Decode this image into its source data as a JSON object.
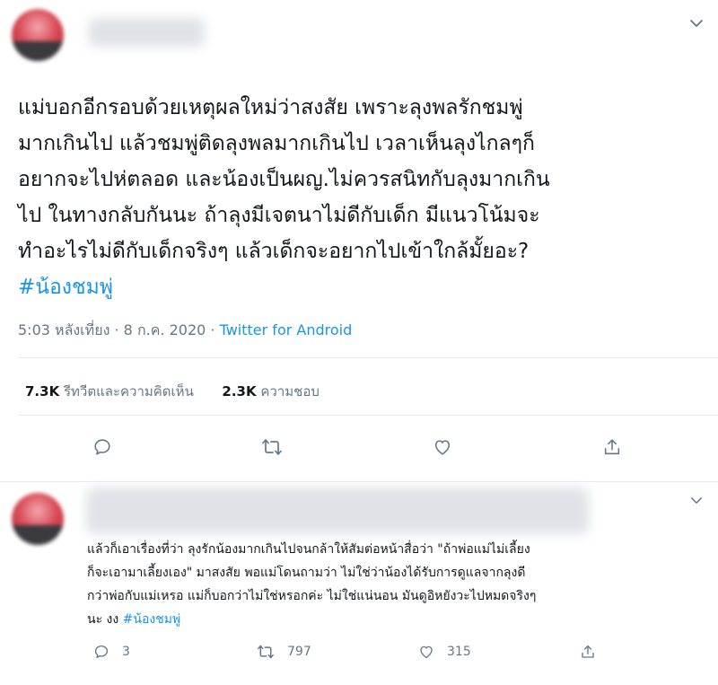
{
  "main_tweet": {
    "text_lines": [
      "แม่บอกอีกรอบด้วยเหตุผลใหม่ว่าสงสัย เพราะลุงพลรักชมพู่",
      "มากเกินไป แล้วชมพู่ติดลุงพลมากเกินไป เวลาเห็นลุงไกลๆก็",
      "อยากจะไปห่ตลอด และน้องเป็นผญ.ไม่ควรสนิทกับลุงมากเกิน",
      "ไป ในทางกลับกันนะ ถ้าลุงมีเจตนาไม่ดีกับเด็ก มีแนวโน้มจะ",
      "ทำอะไรไม่ดีกับเด็กจริงๆ แล้วเด็กจะอยากไปเข้าใกล้มั้ยอะ?"
    ],
    "hashtag": "#น้องชมพู่",
    "time": "5:03 หลังเที่ยง",
    "separator": "·",
    "date": "8 ก.ค. 2020",
    "source": "Twitter for Android",
    "retweets_count": "7.3K",
    "retweets_label": "รีทวีตและความคิดเห็น",
    "likes_count": "2.3K",
    "likes_label": "ความชอบ"
  },
  "reply_tweet": {
    "text_lines": [
      "แล้วก็เอาเรื่องที่ว่า ลุงรักน้องมากเกินไปจนกล้าให้สัมต่อหน้าสื่อว่า \"ถ้าพ่อแม่ไม่เลี้ยง",
      "ก็จะเอามาเลี้ยงเอง\" มาสงสัย พอแม่โดนถามว่า ไม่ใช่ว่าน้องได้รับการดูแลจากลุงดี",
      "กว่าพ่อกับแม่เหรอ แม่ก็บอกว่าไม่ใช่หรอกค่ะ ไม่ใช่แน่นอน มันดูอิหยังวะไปหมดจริงๆ"
    ],
    "last_line_prefix": "นะ งง ",
    "hashtag": "#น้องชมพู่",
    "reply_count": "3",
    "retweet_count": "797",
    "like_count": "315"
  },
  "icons": {
    "menu": "chevron-down-icon",
    "reply": "reply-icon",
    "retweet": "retweet-icon",
    "like": "heart-icon",
    "share": "share-icon"
  },
  "colors": {
    "link": "#1b95e0",
    "secondary_text": "#657786",
    "divider": "#e6ecf0"
  }
}
